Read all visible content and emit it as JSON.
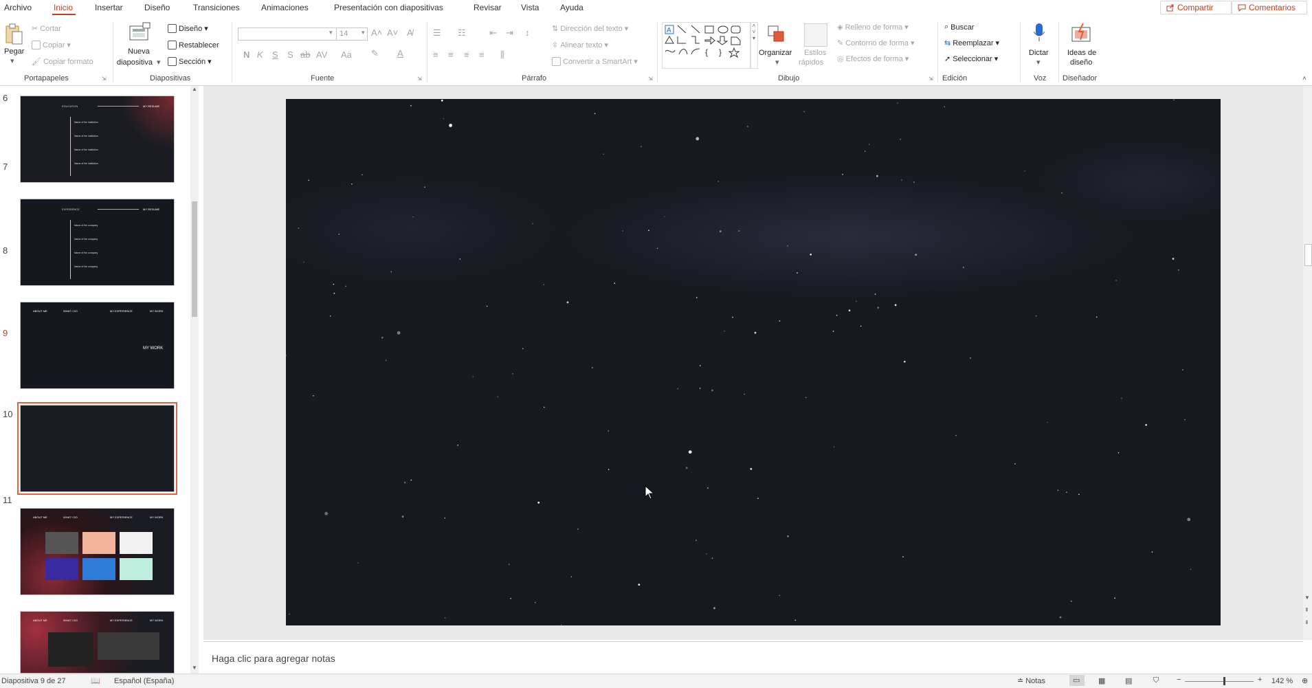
{
  "menu": {
    "items": [
      "Archivo",
      "Inicio",
      "Insertar",
      "Diseño",
      "Transiciones",
      "Animaciones",
      "Presentación con diapositivas",
      "Revisar",
      "Vista",
      "Ayuda"
    ],
    "active": "Inicio",
    "share_label": "Compartir",
    "comments_label": "Comentarios"
  },
  "ribbon": {
    "clipboard": {
      "paste": "Pegar",
      "cut": "Cortar",
      "copy": "Copiar",
      "format_painter": "Copiar formato",
      "group": "Portapapeles"
    },
    "slides": {
      "new_slide_1": "Nueva",
      "new_slide_2": "diapositiva",
      "layout": "Diseño",
      "reset": "Restablecer",
      "section": "Sección",
      "group": "Diapositivas"
    },
    "font": {
      "font_size": "14",
      "bold": "N",
      "italic": "K",
      "underline": "S",
      "shadow": "S",
      "strike": "ab",
      "spacing": "AV",
      "case": "Aa",
      "group": "Fuente"
    },
    "paragraph": {
      "text_direction": "Dirección del texto",
      "align_text": "Alinear texto",
      "smartart": "Convertir a SmartArt",
      "group": "Párrafo"
    },
    "drawing": {
      "arrange": "Organizar",
      "quick_styles_1": "Estilos",
      "quick_styles_2": "rápidos",
      "fill": "Relleno de forma",
      "outline": "Contorno de forma",
      "effects": "Efectos de forma",
      "group": "Dibujo"
    },
    "editing": {
      "find": "Buscar",
      "replace": "Reemplazar",
      "select": "Seleccionar",
      "group": "Edición"
    },
    "voice": {
      "dictate": "Dictar",
      "group": "Voz"
    },
    "designer": {
      "ideas_1": "Ideas de",
      "ideas_2": "diseño",
      "group": "Diseñador"
    }
  },
  "thumbnails": [
    {
      "num": "6",
      "title": "EDUCATION",
      "tag": "MY RESUME",
      "rows": [
        "Name of the institution",
        "Name of the institution",
        "Name of the institution",
        "Name of the institution"
      ]
    },
    {
      "num": "7",
      "title": "EXPERIENCE",
      "tag": "MY RESUME",
      "rows": [
        "Name of the company",
        "Name of the company",
        "Name of the company",
        "Name of the company"
      ]
    },
    {
      "num": "8",
      "nav": [
        "ABOUT ME",
        "WHAT I DO",
        "MY EXPERIENCE",
        "MY WORK"
      ],
      "big": "MY WORK"
    },
    {
      "num": "9",
      "selected": true
    },
    {
      "num": "10",
      "nav": [
        "ABOUT ME",
        "WHAT I DO",
        "MY EXPERIENCE",
        "MY WORK"
      ]
    },
    {
      "num": "11",
      "nav": [
        "ABOUT ME",
        "WHAT I DO",
        "MY EXPERIENCE",
        "MY WORK"
      ]
    }
  ],
  "notes_placeholder": "Haga clic para agregar notas",
  "status": {
    "slide_counter": "Diapositiva 9 de 27",
    "language": "Español (España)",
    "notes": "Notas",
    "zoom": "142 %"
  },
  "colors": {
    "accent": "#c43e1c",
    "slide_bg": "#171920"
  }
}
